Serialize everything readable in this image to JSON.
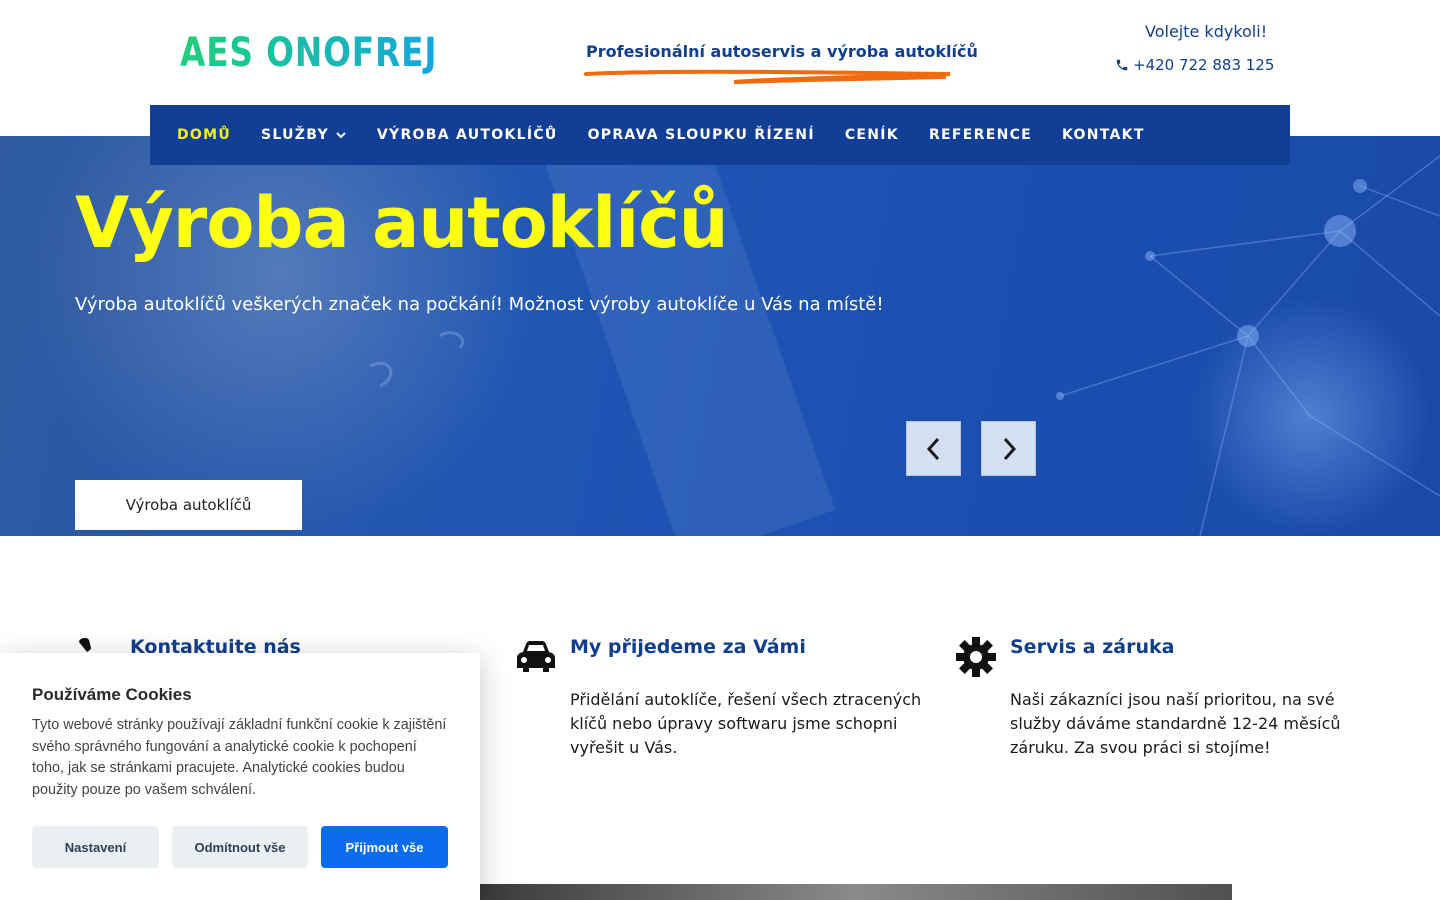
{
  "header": {
    "logo_text": "AES ONOFREJ",
    "tagline": "Profesionální autoservis a výroba autoklíčů",
    "call_label": "Volejte kdykoli!",
    "phone": "+420 722 883 125"
  },
  "nav": {
    "items": [
      {
        "label": "DOMŮ",
        "active": true
      },
      {
        "label": "SLUŽBY",
        "dropdown": true
      },
      {
        "label": "VÝROBA AUTOKLÍČŮ"
      },
      {
        "label": "OPRAVA SLOUPKU ŘÍZENÍ"
      },
      {
        "label": "CENÍK"
      },
      {
        "label": "REFERENCE"
      },
      {
        "label": "KONTAKT"
      }
    ]
  },
  "hero": {
    "title": "Výroba autoklíčů",
    "subtitle": "Výroba autoklíčů veškerých značek na počkání! Možnost výroby autoklíče u Vás na místě!",
    "cta_label": "Výroba autoklíčů"
  },
  "features": [
    {
      "icon": "phone-icon",
      "title": "Kontaktuite nás",
      "text": ""
    },
    {
      "icon": "car-icon",
      "title": "My přijedeme za Vámi",
      "text": "Přidělání autoklíče, řešení všech ztracených klíčů nebo úpravy softwaru jsme schopni vyřešit u Vás."
    },
    {
      "icon": "gear-icon",
      "title": "Servis a záruka",
      "text": "Naši zákazníci jsou naší prioritou, na své služby dáváme standardně 12-24 měsíců záruku. Za svou práci si stojíme!"
    }
  ],
  "cookie": {
    "title": "Používáme Cookies",
    "text": "Tyto webové stránky používají základní funkční cookie k zajištění svého správného fungování a analytické cookie k pochopení toho, jak se stránkami pracujete. Analytické cookies budou použity pouze po vašem schválení.",
    "settings_label": "Nastavení",
    "reject_label": "Odmítnout vše",
    "accept_label": "Přijmout vše"
  },
  "colors": {
    "nav_bg": "#123f96",
    "accent_yellow": "#ffff14",
    "brand_blue": "#123f8a",
    "cookie_accept": "#0b6cf0",
    "tagline_stroke": "#f06a0f"
  }
}
